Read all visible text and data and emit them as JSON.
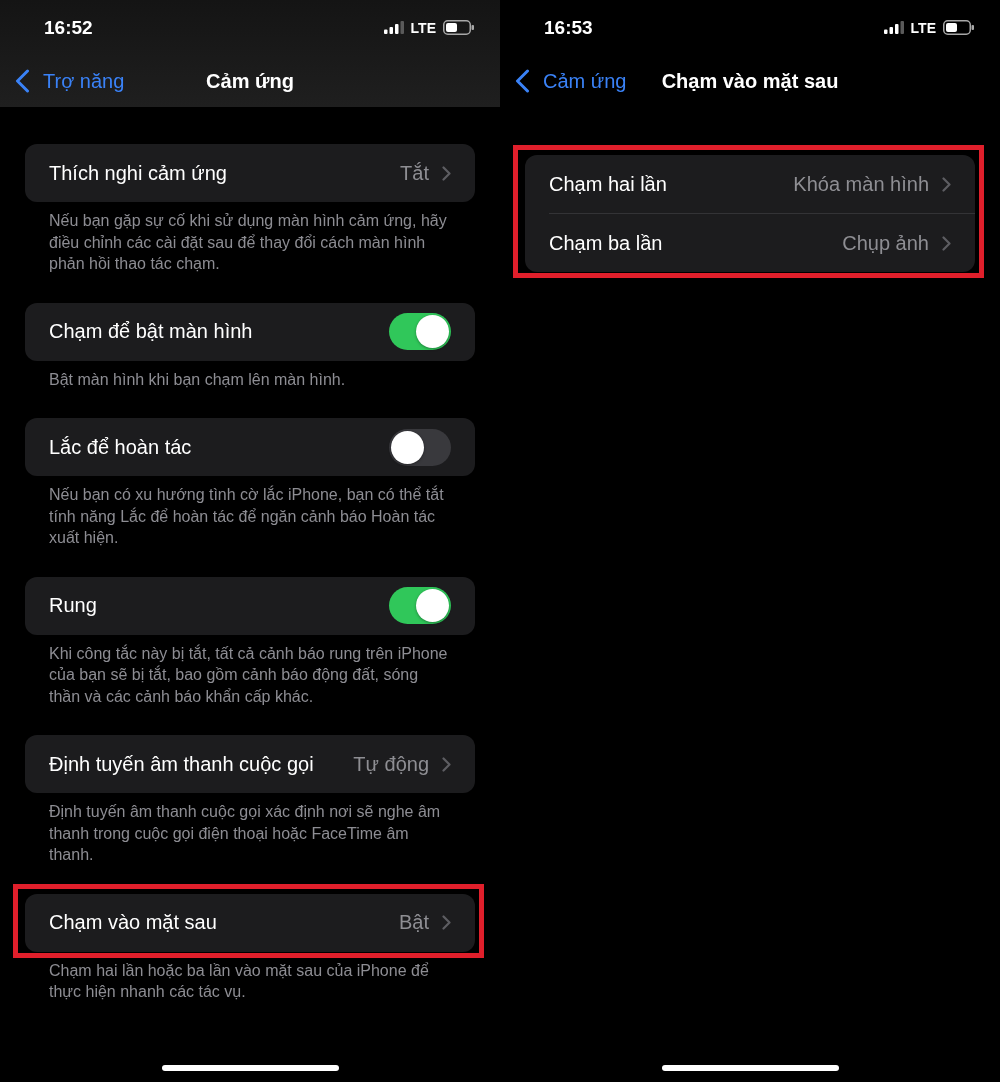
{
  "screens": [
    {
      "status_bar": {
        "time": "16:52",
        "network": "LTE"
      },
      "nav_bar": {
        "back_label": "Trợ năng",
        "title": "Cảm ứng",
        "filled": true
      },
      "groups": [
        {
          "highlighted": false,
          "rows": [
            {
              "kind": "link",
              "label": "Thích nghi cảm ứng",
              "value": "Tắt"
            }
          ],
          "footer": "Nếu bạn gặp sự cố khi sử dụng màn hình cảm ứng, hãy điều chỉnh các cài đặt sau để thay đổi cách màn hình phản hồi thao tác chạm."
        },
        {
          "highlighted": false,
          "rows": [
            {
              "kind": "toggle",
              "label": "Chạm để bật màn hình",
              "on": true
            }
          ],
          "footer": "Bật màn hình khi bạn chạm lên màn hình."
        },
        {
          "highlighted": false,
          "rows": [
            {
              "kind": "toggle",
              "label": "Lắc để hoàn tác",
              "on": false
            }
          ],
          "footer": "Nếu bạn có xu hướng tình cờ lắc iPhone, bạn có thể tắt tính năng Lắc để hoàn tác để ngăn cảnh báo Hoàn tác xuất hiện."
        },
        {
          "highlighted": false,
          "rows": [
            {
              "kind": "toggle",
              "label": "Rung",
              "on": true
            }
          ],
          "footer": "Khi công tắc này bị tắt, tất cả cảnh báo rung trên iPhone của bạn sẽ bị tắt, bao gồm cảnh báo động đất, sóng thần và các cảnh báo khẩn cấp khác."
        },
        {
          "highlighted": false,
          "rows": [
            {
              "kind": "link",
              "label": "Định tuyến âm thanh cuộc gọi",
              "value": "Tự động"
            }
          ],
          "footer": "Định tuyến âm thanh cuộc gọi xác định nơi sẽ nghe âm thanh trong cuộc gọi điện thoại hoặc FaceTime âm thanh."
        },
        {
          "highlighted": true,
          "rows": [
            {
              "kind": "link",
              "label": "Chạm vào mặt sau",
              "value": "Bật"
            }
          ],
          "footer": "Chạm hai lần hoặc ba lần vào mặt sau của iPhone để thực hiện nhanh các tác vụ."
        }
      ]
    },
    {
      "status_bar": {
        "time": "16:53",
        "network": "LTE"
      },
      "nav_bar": {
        "back_label": "Cảm ứng",
        "title": "Chạm vào mặt sau",
        "filled": false
      },
      "groups": [
        {
          "highlighted": true,
          "rows": [
            {
              "kind": "link",
              "label": "Chạm hai lần",
              "value": "Khóa màn hình"
            },
            {
              "kind": "link",
              "label": "Chạm ba lần",
              "value": "Chụp ảnh"
            }
          ]
        }
      ]
    }
  ]
}
